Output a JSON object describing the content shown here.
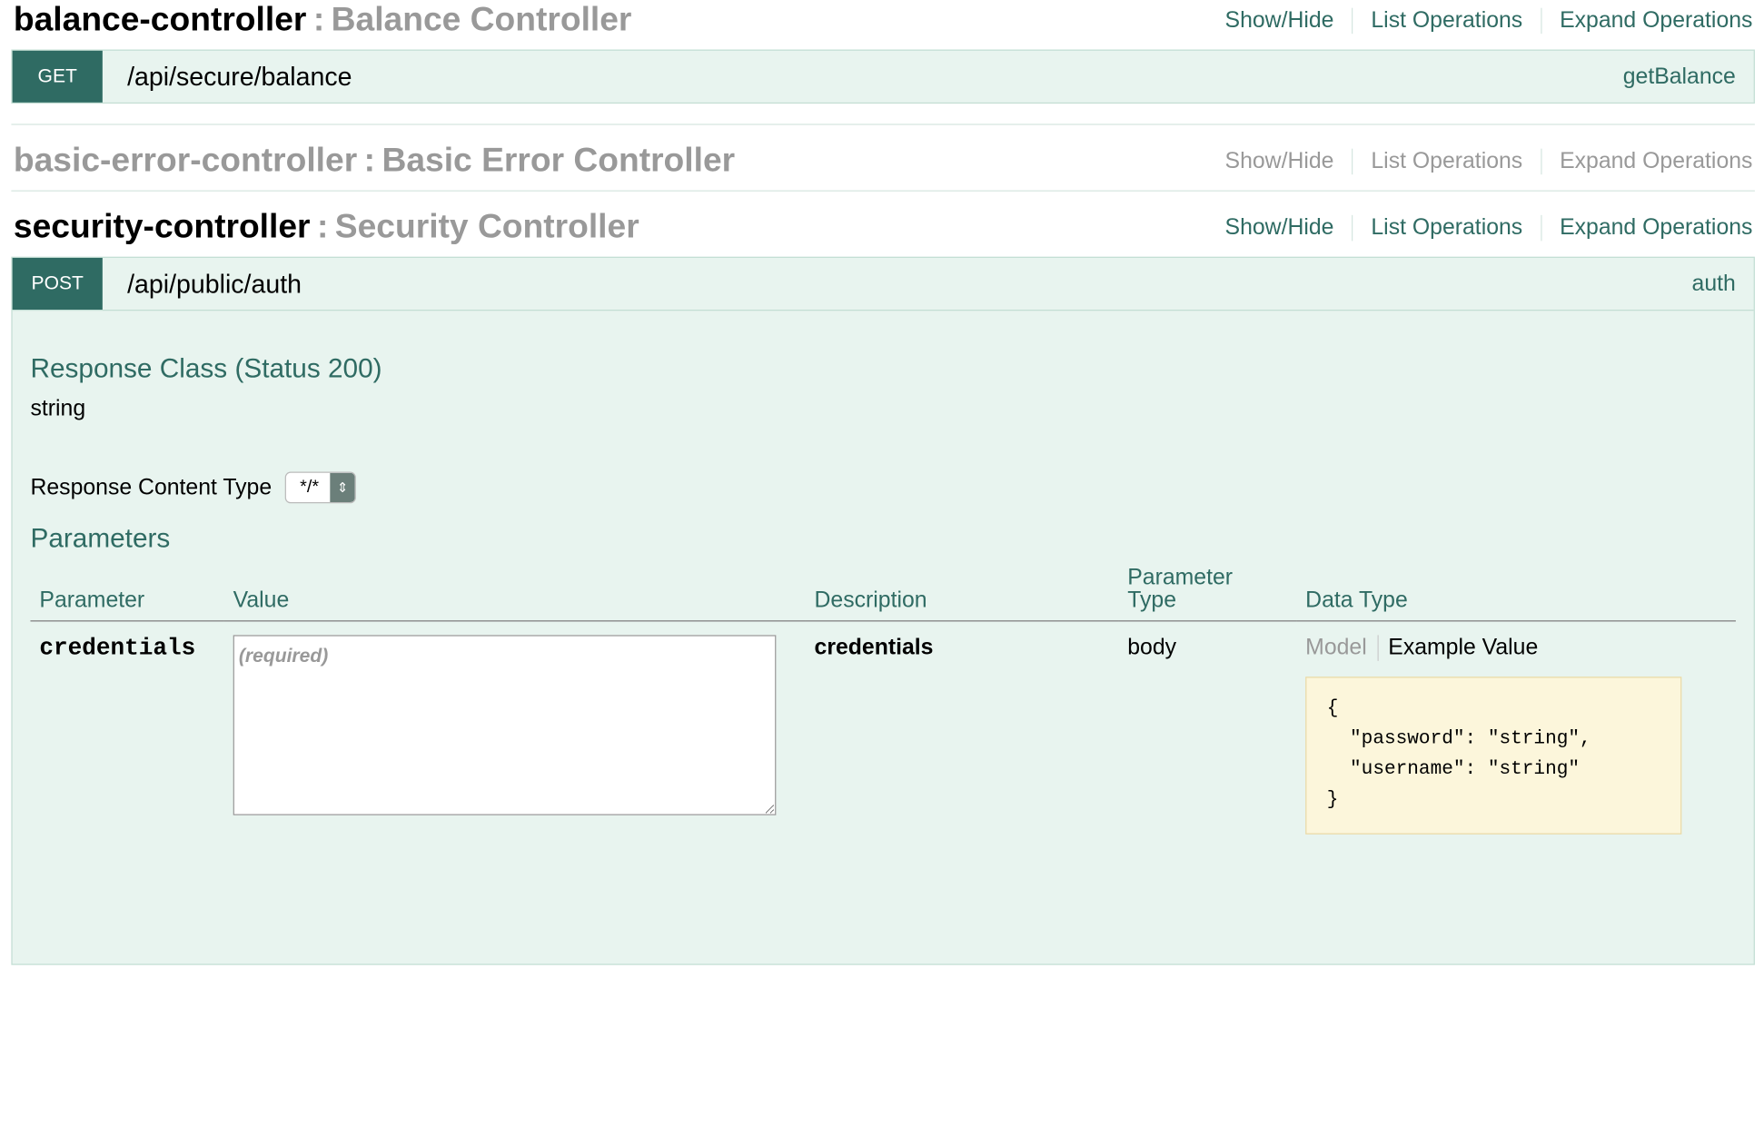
{
  "sections": [
    {
      "name": "balance-controller",
      "description": "Balance Controller",
      "links": [
        "Show/Hide",
        "List Operations",
        "Expand Operations"
      ]
    },
    {
      "name": "basic-error-controller",
      "description": "Basic Error Controller",
      "links": [
        "Show/Hide",
        "List Operations",
        "Expand Operations"
      ]
    },
    {
      "name": "security-controller",
      "description": "Security Controller",
      "links": [
        "Show/Hide",
        "List Operations",
        "Expand Operations"
      ]
    }
  ],
  "separator": ":",
  "operations": {
    "balance": {
      "method": "GET",
      "path": "/api/secure/balance",
      "nickname": "getBalance"
    },
    "auth": {
      "method": "POST",
      "path": "/api/public/auth",
      "nickname": "auth"
    }
  },
  "auth_body": {
    "response_class_title": "Response Class (Status 200)",
    "response_class_value": "string",
    "response_content_type_label": "Response Content Type",
    "response_content_type_value": "*/*",
    "parameters_title": "Parameters",
    "columns": {
      "parameter": "Parameter",
      "value": "Value",
      "description": "Description",
      "parameter_type_line1": "Parameter",
      "parameter_type_line2": "Type",
      "data_type": "Data Type"
    },
    "param": {
      "name": "credentials",
      "placeholder": "(required)",
      "description": "credentials",
      "type": "body",
      "tab_model": "Model",
      "tab_example": "Example Value",
      "example": "{\n  \"password\": \"string\",\n  \"username\": \"string\"\n}"
    }
  },
  "colors": {
    "accent": "#2f6b63",
    "operation_bg": "#e8f4ef",
    "example_bg": "#fcf6db"
  }
}
